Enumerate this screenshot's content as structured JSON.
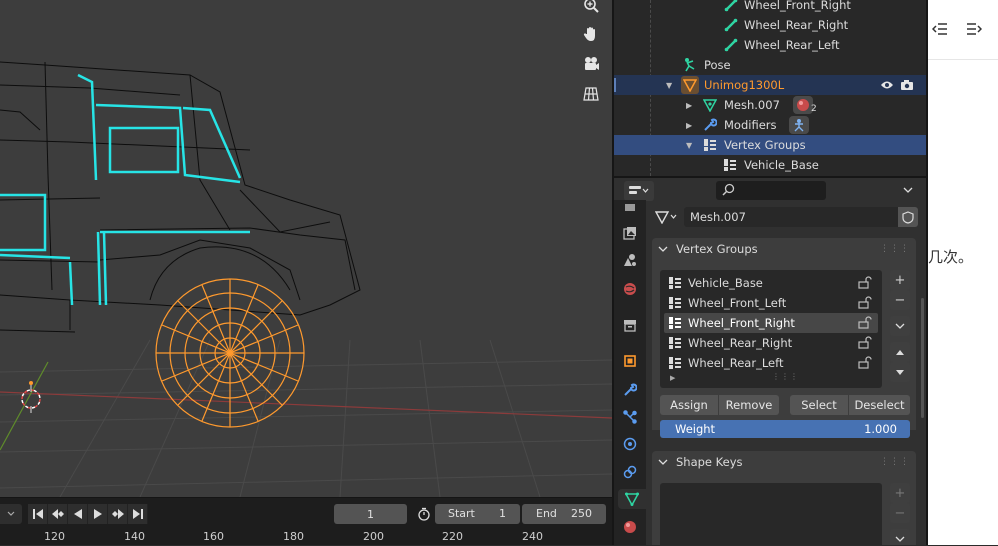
{
  "outliner": {
    "rows": [
      {
        "label": "Wheel_Front_Right"
      },
      {
        "label": "Wheel_Rear_Right"
      },
      {
        "label": "Wheel_Rear_Left"
      },
      {
        "label": "Pose"
      },
      {
        "label": "Unimog1300L"
      },
      {
        "label": "Mesh.007",
        "badge": "2"
      },
      {
        "label": "Modifiers"
      },
      {
        "label": "Vertex Groups"
      },
      {
        "label": "Vehicle_Base"
      }
    ]
  },
  "properties": {
    "search_placeholder": "",
    "mesh_name": "Mesh.007",
    "vertex_groups": {
      "title": "Vertex Groups",
      "items": [
        "Vehicle_Base",
        "Wheel_Front_Left",
        "Wheel_Front_Right",
        "Wheel_Rear_Right",
        "Wheel_Rear_Left"
      ],
      "selected_index": 2,
      "assign": "Assign",
      "remove": "Remove",
      "select": "Select",
      "deselect": "Deselect",
      "weight_label": "Weight",
      "weight_value": "1.000"
    },
    "shape_keys": {
      "title": "Shape Keys"
    }
  },
  "timeline": {
    "current_frame": "1",
    "start_label": "Start",
    "start_value": "1",
    "end_label": "End",
    "end_value": "250",
    "ruler": [
      "120",
      "140",
      "160",
      "180",
      "200",
      "220",
      "240"
    ]
  },
  "doc": {
    "text": "几次。"
  },
  "colors": {
    "wire_selected": "#ff9a2e",
    "wire_cyan": "#27e4e6",
    "active_row": "#334d80",
    "weight_bar": "#4772b3",
    "vgroup_icon": "#2fd5a3"
  }
}
